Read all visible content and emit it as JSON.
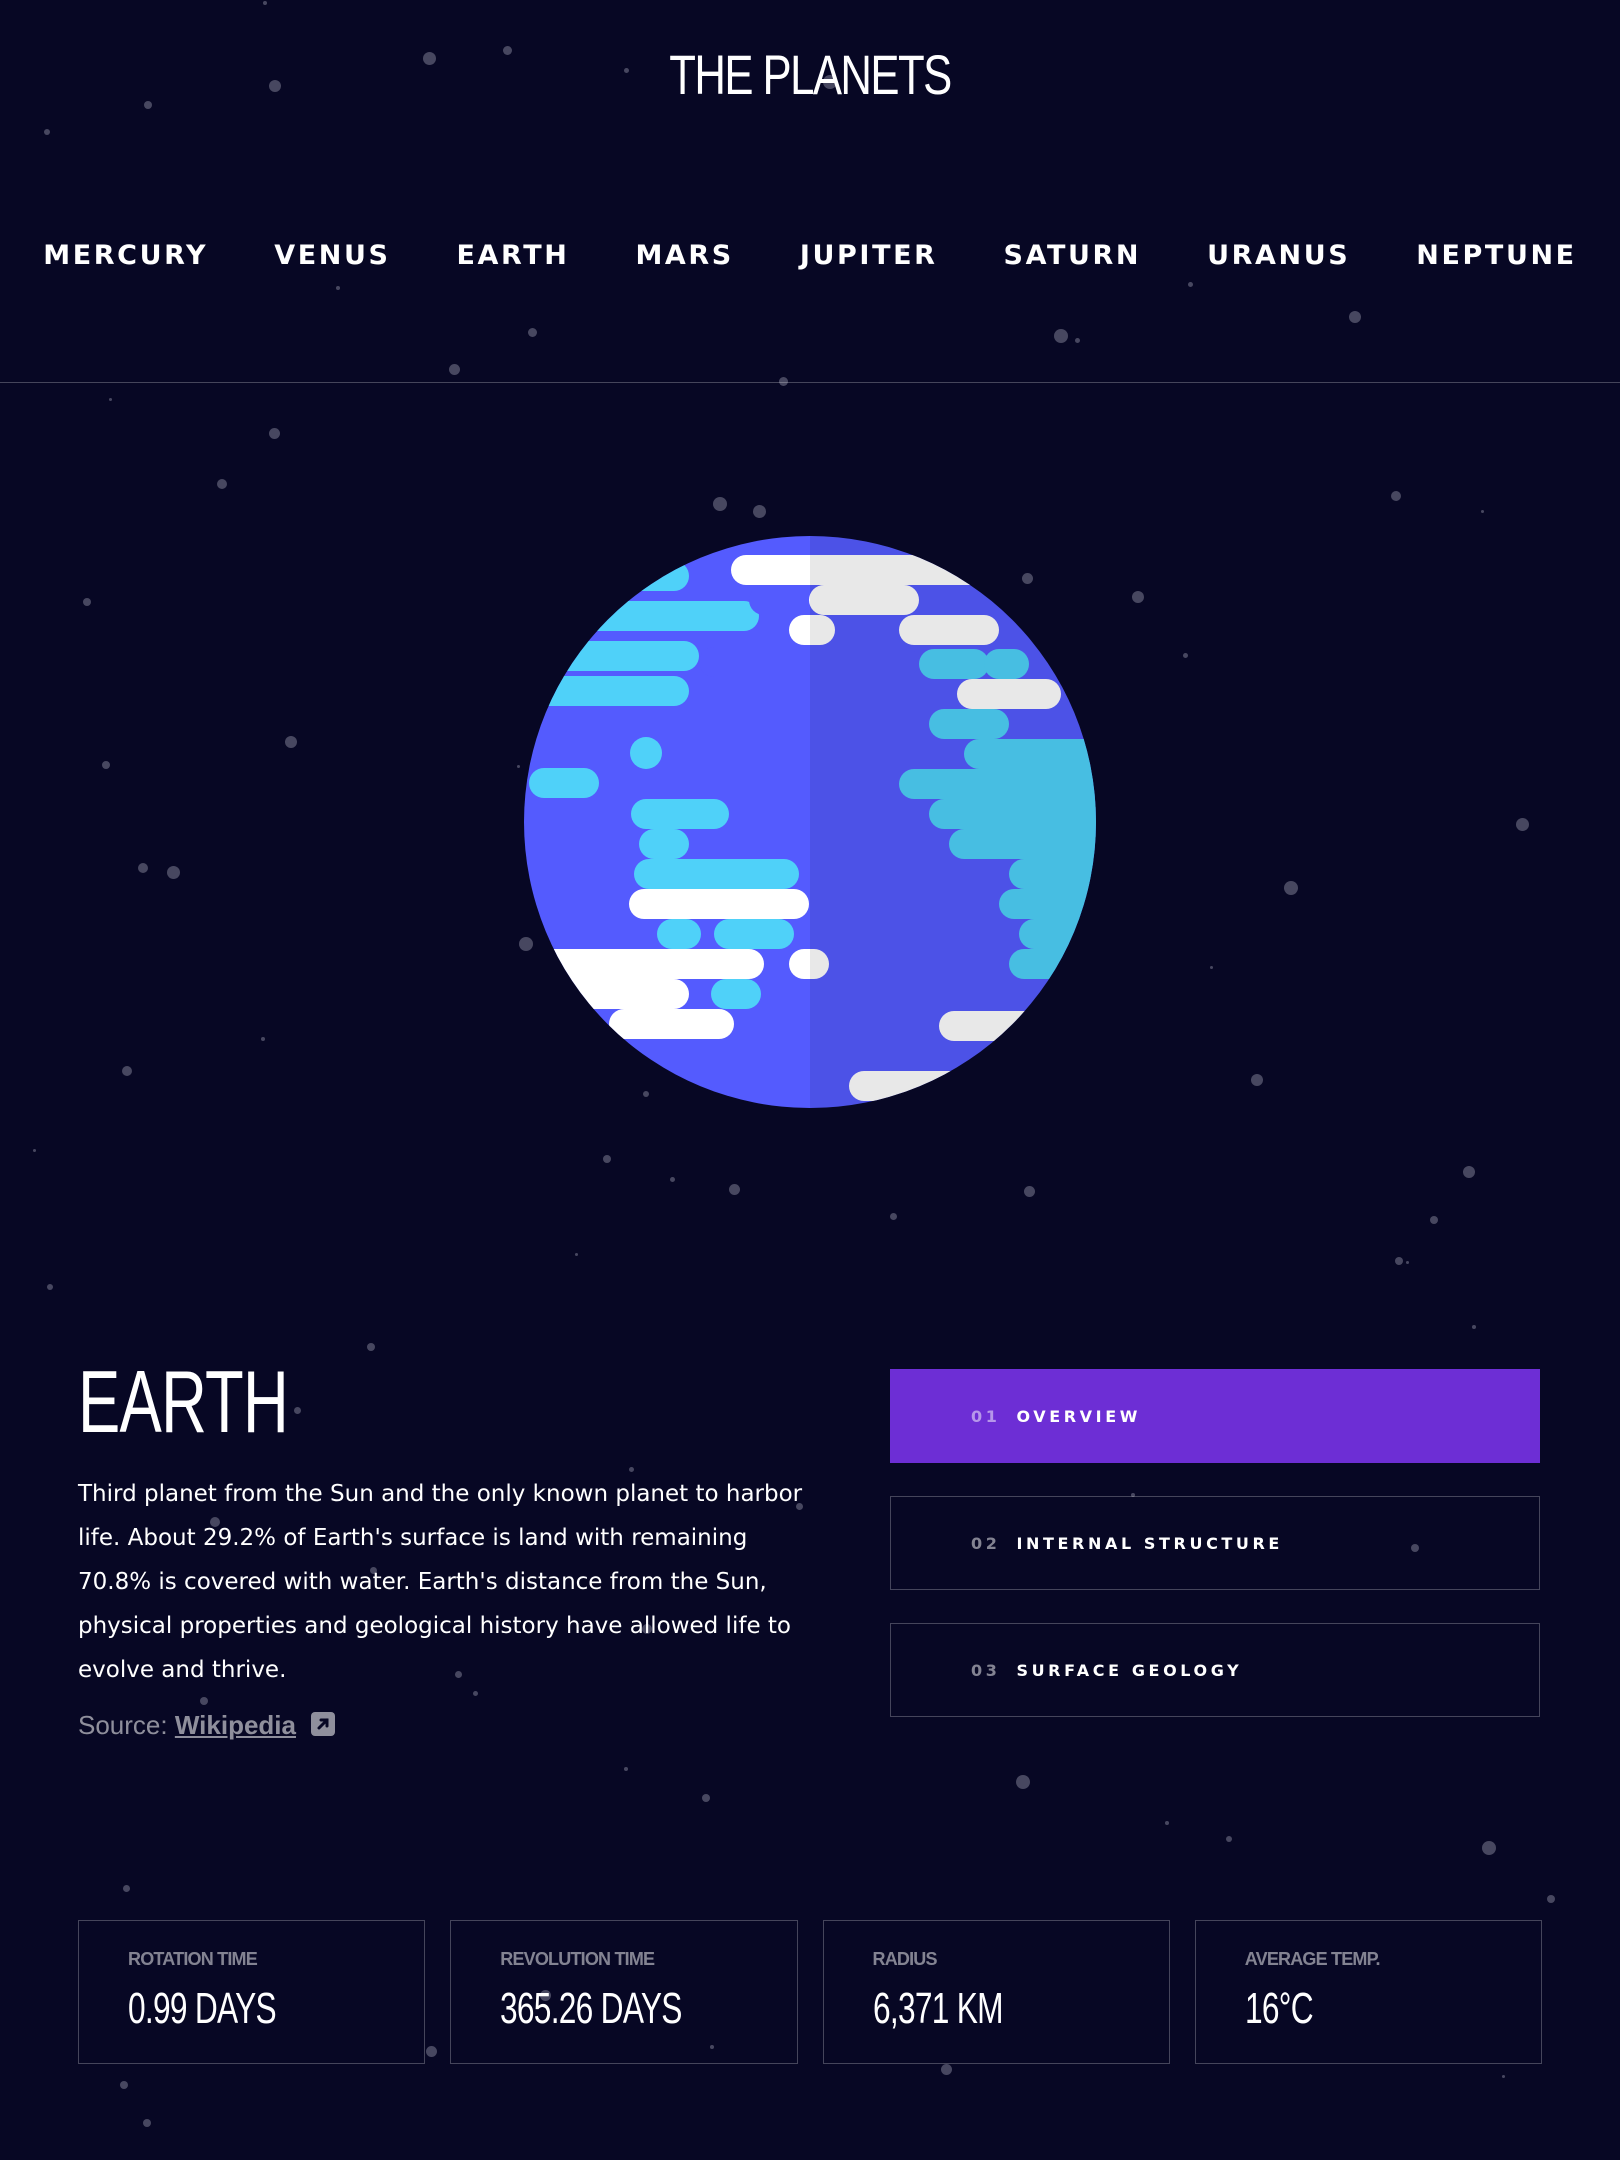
{
  "app": {
    "title": "THE PLANETS"
  },
  "nav": {
    "items": [
      "MERCURY",
      "VENUS",
      "EARTH",
      "MARS",
      "JUPITER",
      "SATURN",
      "URANUS",
      "NEPTUNE"
    ]
  },
  "planet": {
    "name": "EARTH",
    "description": "Third planet from the Sun and the only known planet to harbor life. About 29.2% of Earth's surface is land with remaining 70.8% is covered with water. Earth's distance from the Sun, physical properties and geological history have allowed life to evolve and thrive.",
    "source_label": "Source:",
    "source_link": "Wikipedia",
    "icon": "earth-globe-icon"
  },
  "tabs": [
    {
      "num": "01",
      "label": "OVERVIEW",
      "active": true
    },
    {
      "num": "02",
      "label": "INTERNAL STRUCTURE",
      "active": false
    },
    {
      "num": "03",
      "label": "SURFACE GEOLOGY",
      "active": false
    }
  ],
  "stats": [
    {
      "label": "Rotation Time",
      "value": "0.99 DAYS"
    },
    {
      "label": "Revolution Time",
      "value": "365.26 DAYS"
    },
    {
      "label": "Radius",
      "value": "6,371 KM"
    },
    {
      "label": "Average Temp.",
      "value": "16°C"
    }
  ],
  "colors": {
    "background": "#070724",
    "accent": "#6D2ED5",
    "ocean": "#545BFE",
    "land": "#4FD1F9",
    "cloud": "#FFFFFF"
  }
}
